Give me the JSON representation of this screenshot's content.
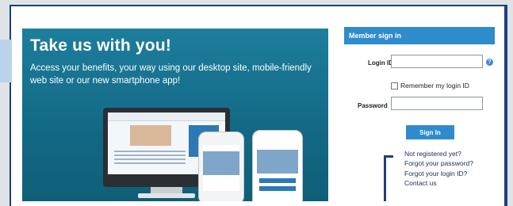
{
  "promo": {
    "title": "Take us with you!",
    "body": "Access your benefits, your way using our desktop site, mobile-friendly web site or our new smartphone app!"
  },
  "login": {
    "header": "Member sign in",
    "login_id_label": "Login ID",
    "login_id_value": "",
    "help_icon_glyph": "?",
    "remember_label": "Remember my login ID",
    "remember_checked": false,
    "password_label": "Password",
    "password_value": "",
    "sign_in_label": "Sign In",
    "links": [
      "Not registered yet?",
      "Forgot your password?",
      "Forgot your login ID?",
      "Contact us"
    ]
  },
  "colors": {
    "accent": "#2f8ccc",
    "frame": "#1f3f7a",
    "promo_bg": "#136a86"
  }
}
